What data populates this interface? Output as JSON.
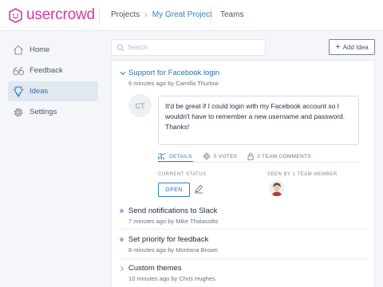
{
  "brand": {
    "name": "usercrowd",
    "color": "#d63aa6"
  },
  "breadcrumb": {
    "projects": "Projects",
    "separator": "›",
    "current": "My Great Project"
  },
  "teams_label": "Teams",
  "sidebar": {
    "items": [
      {
        "label": "Home",
        "icon": "home-icon",
        "active": false
      },
      {
        "label": "Feedback",
        "icon": "quote-icon",
        "active": false
      },
      {
        "label": "Ideas",
        "icon": "lightbulb-icon",
        "active": true
      },
      {
        "label": "Settings",
        "icon": "gear-icon",
        "active": false
      }
    ]
  },
  "search": {
    "placeholder": "Search",
    "value": ""
  },
  "add_idea_label": "Add Idea",
  "expanded_idea": {
    "title": "Support for Facebook login",
    "meta": "6 minutes ago by Camilla Thurlow",
    "avatar_initials": "CT",
    "body": "It'd be great if I could login with my Facebook account so I wouldn't have to remember a new username and password. Thanks!",
    "tabs": {
      "details": "DETAILS",
      "votes": "0 VOTES",
      "comments": "0 TEAM COMMENTS"
    },
    "status_label": "CURRENT STATUS",
    "status_value": "OPEN",
    "seen_label": "SEEN BY 1 TEAM MEMBER"
  },
  "ideas": [
    {
      "title": "Send notifications to Slack",
      "meta": "7 minutes ago by Mike Thalassitis",
      "marker": "dot"
    },
    {
      "title": "Set priority for feedback",
      "meta": "8 minutes ago by Montana Brown",
      "marker": "dot"
    },
    {
      "title": "Custom themes",
      "meta": "10 minutes ago by Chris Hughes",
      "marker": "chevron"
    }
  ],
  "colors": {
    "accent": "#2f7fc1",
    "unread_dot": "#8fb3d9",
    "background": "#f4f6f9"
  }
}
